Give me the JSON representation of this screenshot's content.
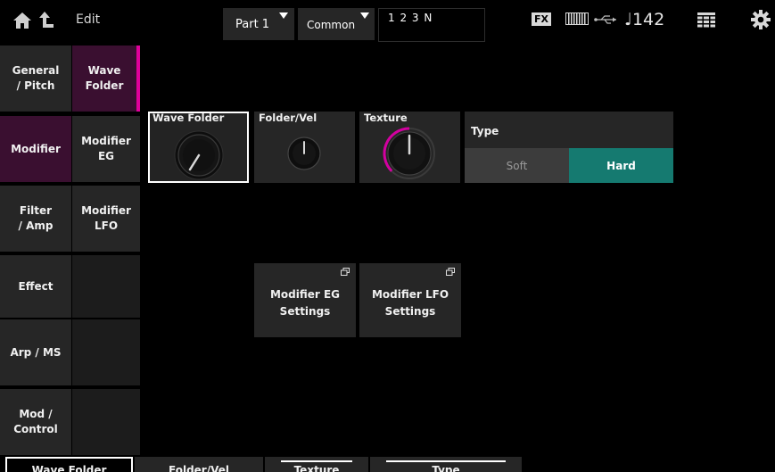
{
  "topbar": {
    "edit_label": "Edit",
    "part_label": "Part 1",
    "common_label": "Common",
    "performance_name": "1 2 3 N",
    "fx_label": "FX",
    "tempo": "♩142"
  },
  "nav": {
    "col1": [
      {
        "label": "General\n/ Pitch"
      },
      {
        "label": "Modifier"
      },
      {
        "label": "Filter\n/ Amp"
      },
      {
        "label": "Effect"
      },
      {
        "label": "Arp / MS"
      },
      {
        "label": "Mod /\nControl"
      }
    ],
    "col2": [
      {
        "label": "Wave\nFolder"
      },
      {
        "label": "Modifier EG"
      },
      {
        "label": "Modifier\nLFO"
      },
      {
        "label": ""
      },
      {
        "label": ""
      },
      {
        "label": ""
      }
    ]
  },
  "params": {
    "wave_folder": {
      "label": "Wave Folder"
    },
    "folder_vel": {
      "label": "Folder/Vel"
    },
    "texture": {
      "label": "Texture"
    },
    "type": {
      "label": "Type",
      "options": [
        "Soft",
        "Hard"
      ],
      "selected": "Hard"
    }
  },
  "buttons": {
    "modifier_eg_settings": "Modifier EG\nSettings",
    "modifier_lfo_settings": "Modifier LFO\nSettings"
  },
  "bottom_tabs": [
    "Wave Folder",
    "Folder/Vel",
    "Texture",
    "Type"
  ],
  "colors": {
    "accent_magenta": "#e0009a",
    "type_selected": "#157a70",
    "panel": "#262626"
  }
}
